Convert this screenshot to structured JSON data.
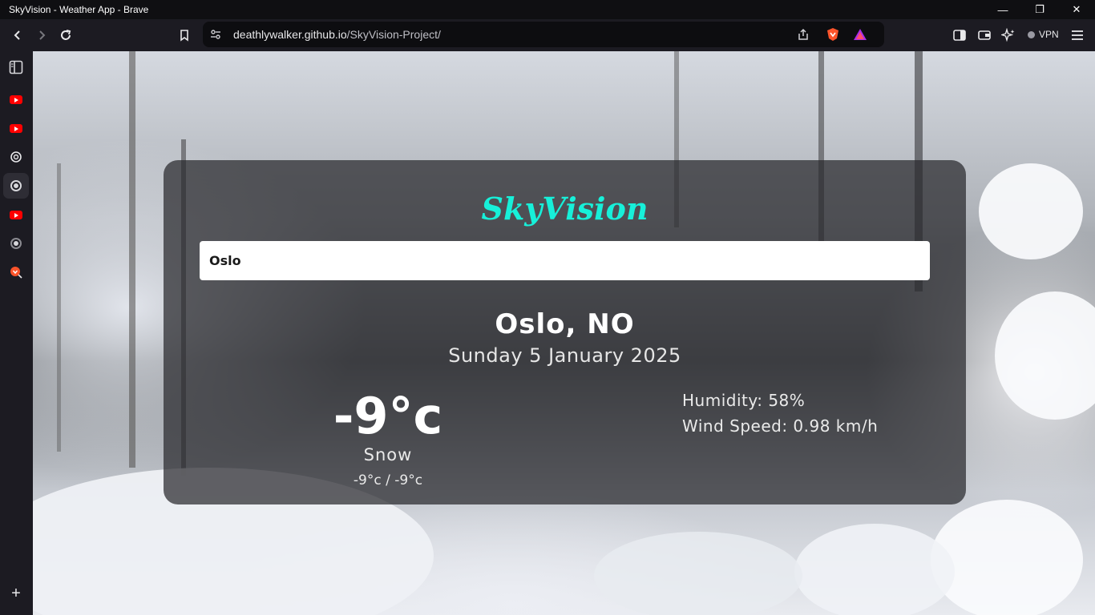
{
  "window": {
    "title": "SkyVision - Weather App - Brave",
    "minimize_glyph": "—",
    "restore_glyph": "❐",
    "close_glyph": "✕"
  },
  "toolbar": {
    "url_host": "deathlywalker.github.io",
    "url_path": "/SkyVision-Project/",
    "vpn_label": "VPN"
  },
  "sidebar": {
    "items": [
      {
        "icon": "sidebar-panel-icon"
      },
      {
        "icon": "youtube-icon"
      },
      {
        "icon": "youtube-icon"
      },
      {
        "icon": "chatgpt-icon"
      },
      {
        "icon": "globe-icon",
        "active": true
      },
      {
        "icon": "youtube-icon"
      },
      {
        "icon": "globe-icon"
      },
      {
        "icon": "brave-search-icon"
      }
    ],
    "add_glyph": "+"
  },
  "app": {
    "brand": "SkyVision",
    "search_value": "Oslo",
    "location": "Oslo, NO",
    "date": "Sunday 5 January 2025",
    "temperature": "-9°c",
    "condition": "Snow",
    "min_max": "-9°c / -9°c",
    "humidity": "Humidity: 58%",
    "wind_speed": "Wind Speed: 0.98 km/h"
  },
  "colors": {
    "brand": "#17f0d9",
    "card_bg": "rgba(40,40,44,0.72)"
  }
}
